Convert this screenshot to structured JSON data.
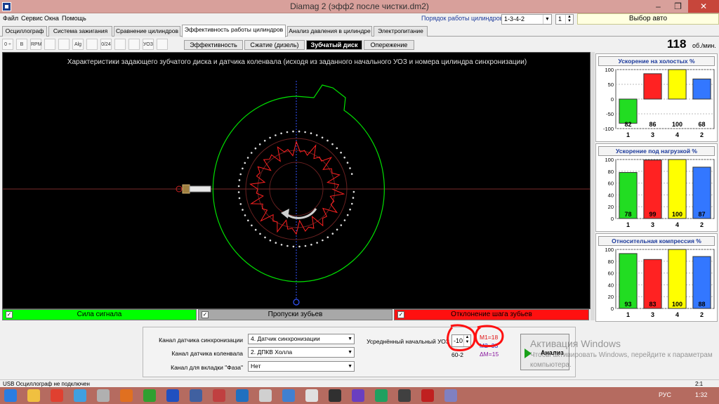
{
  "window": {
    "title": "Diamag 2 (эфф2 после чистки.dm2)"
  },
  "menu": [
    "Файл",
    "Сервис",
    "Окна",
    "Помощь"
  ],
  "cylinder_order": {
    "label": "Порядок работы цилиндров",
    "value": "1-3-4-2",
    "spin_value": "1"
  },
  "choose_car_label": "Выбор авто",
  "main_tabs": [
    "Осциллограф",
    "Система зажигания",
    "Сравнение цилиндров",
    "Эффективность работы цилиндров",
    "Анализ давления в цилиндре",
    "Электропитание"
  ],
  "toolbar_icons": [
    "scale-icon",
    "bar-icon",
    "rpm-icon",
    "zoom-icon",
    "wave-icon",
    "half-icon",
    "chart-icon",
    "percent-icon",
    "tune-icon",
    "bars-icon",
    "yoz-icon",
    "report-icon"
  ],
  "toolbar_labels": [
    "0 ÷",
    "B",
    "RPM",
    "",
    "",
    "Alg 1/2",
    "",
    "0/24",
    "",
    "",
    "УОЗ",
    ""
  ],
  "sub_tabs": [
    "Эффективность",
    "Сжатие (дизель)",
    "Зубчатый диск",
    "Опережение"
  ],
  "rpm": {
    "value": "118",
    "unit": "об./мин."
  },
  "plot": {
    "title": "Характеристики задающего зубчатого диска и датчика коленвала (исходя из заданного начального УОЗ и номера цилиндра синхронизации)"
  },
  "legend": [
    {
      "label": "Сила сигнала",
      "color": "#00ff00"
    },
    {
      "label": "Пропуски зубьев",
      "color": "#a8a8a8"
    },
    {
      "label": "Отклонение шага зубьев",
      "color": "#ff1010"
    }
  ],
  "bottom_panel": {
    "sync_channel_label": "Канал датчика синхронизации",
    "sync_channel_value": "4. Датчик синхронизации",
    "crank_channel_label": "Канал датчика коленвала",
    "crank_channel_value": "2. ДПКВ Холла",
    "phase_tab_label": "Канал для вкладки \"Фаза\"",
    "phase_tab_value": "Нет",
    "avg_uoz_label": "Усреднённый начальный УОЗ",
    "avg_uoz_value": "-10",
    "m1": "M1=18",
    "m2": "M2=33",
    "dm": "ΔM=15",
    "sixty": "60-2",
    "analysis_button": "Анализ"
  },
  "watermark": {
    "line1": "Активация Windows",
    "line2": "Чтобы активировать Windows, перейдите к параметрам компьютера."
  },
  "charts": [
    {
      "title": "Ускорение на холостых %",
      "type": "bar",
      "ylim": [
        -100,
        100
      ],
      "yticks": [
        "100",
        "50",
        "0",
        "-50",
        "-100"
      ],
      "categories": [
        "1",
        "3",
        "4",
        "2"
      ],
      "values": [
        -82,
        86,
        100,
        68
      ],
      "labels": [
        "82",
        "86",
        "100",
        "68"
      ],
      "colors": [
        "#22dd22",
        "#ff2222",
        "#ffff00",
        "#3377ff"
      ]
    },
    {
      "title": "Ускорение под нагрузкой %",
      "type": "bar",
      "ylim": [
        0,
        100
      ],
      "yticks": [
        "100",
        "80",
        "60",
        "40",
        "20",
        "0"
      ],
      "categories": [
        "1",
        "3",
        "4",
        "2"
      ],
      "values": [
        78,
        99,
        100,
        87
      ],
      "labels": [
        "78",
        "99",
        "100",
        "87"
      ],
      "colors": [
        "#22dd22",
        "#ff2222",
        "#ffff00",
        "#3377ff"
      ]
    },
    {
      "title": "Относительная компрессия %",
      "type": "bar",
      "ylim": [
        0,
        100
      ],
      "yticks": [
        "100",
        "80",
        "60",
        "40",
        "20",
        "0"
      ],
      "categories": [
        "1",
        "3",
        "4",
        "2"
      ],
      "values": [
        93,
        83,
        100,
        88
      ],
      "labels": [
        "93",
        "83",
        "100",
        "88"
      ],
      "colors": [
        "#22dd22",
        "#ff2222",
        "#ffff00",
        "#3377ff"
      ]
    }
  ],
  "status": {
    "left": "USB Осциллограф не подключен",
    "right": "2:1"
  },
  "tray": {
    "lang": "РУС",
    "time": "1:32"
  }
}
